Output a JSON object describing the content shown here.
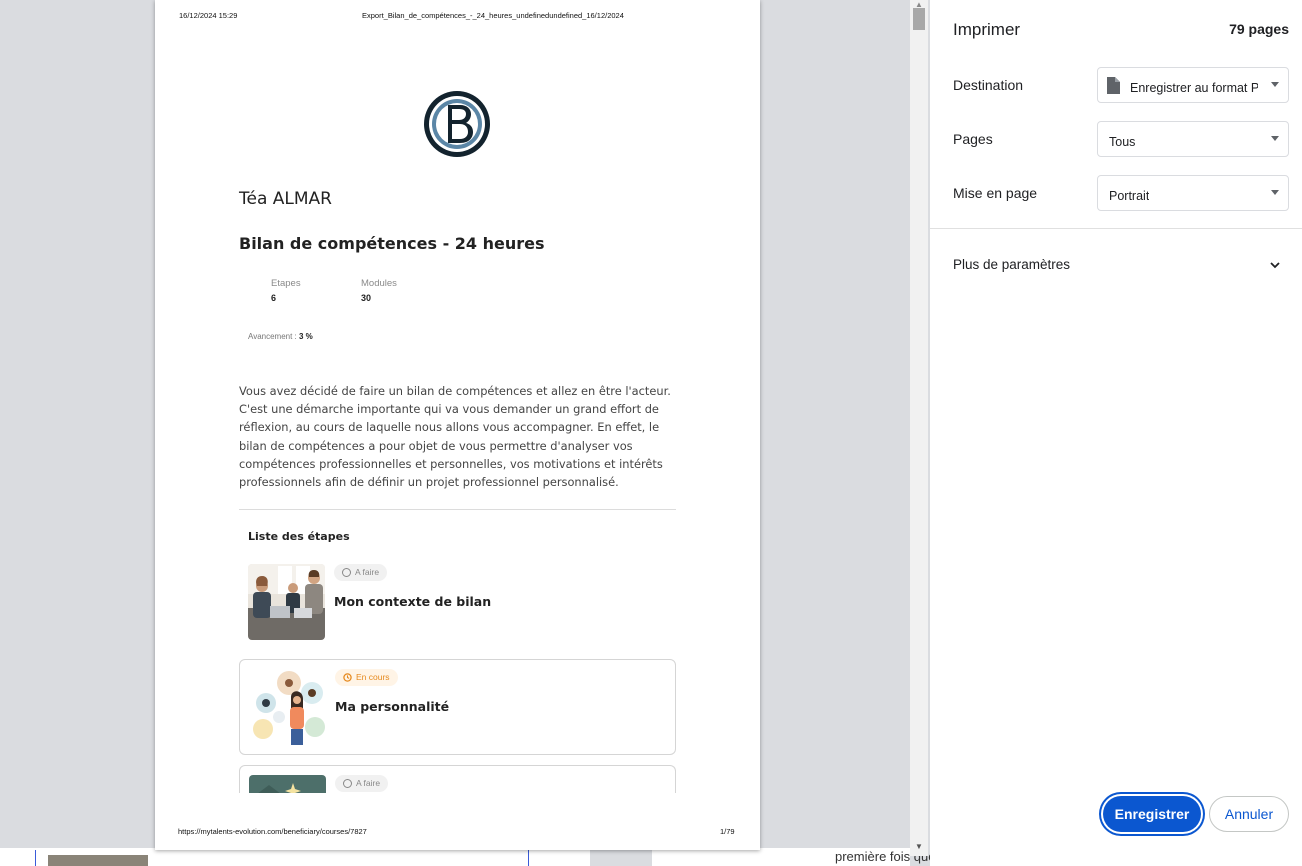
{
  "preview": {
    "header_date": "16/12/2024 15:29",
    "header_title": "Export_Bilan_de_compétences_-_24_heures_undefinedundefined_16/12/2024",
    "person_name": "Téa ALMAR",
    "course_title": "Bilan de compétences - 24 heures",
    "stats": [
      {
        "label": "Etapes",
        "value": "6"
      },
      {
        "label": "Modules",
        "value": "30"
      }
    ],
    "progress_label": "Avancement : ",
    "progress_value": "3 %",
    "intro_text": "Vous avez décidé de faire un bilan de compétences et allez en être l'acteur. C'est une démarche importante qui va vous demander un grand effort de réflexion, au cours de laquelle nous allons vous accompagner. En effet, le bilan de compétences a pour objet de vous permettre d'analyser vos compétences professionnelles et personnelles, vos motivations et intérêts professionnels afin de définir un projet professionnel personnalisé.",
    "steps_title": "Liste des étapes",
    "steps": [
      {
        "status": "A faire",
        "title": "Mon contexte de bilan"
      },
      {
        "status": "En cours",
        "title": "Ma personnalité"
      },
      {
        "status": "A faire",
        "title": ""
      }
    ],
    "footer_url": "https://mytalents-evolution.com/beneficiary/courses/7827",
    "footer_page": "1/79"
  },
  "background": {
    "text": "première fois que vous"
  },
  "print": {
    "title": "Imprimer",
    "page_count": "79 pages",
    "destination_label": "Destination",
    "destination_value": "Enregistrer au format PDF",
    "pages_label": "Pages",
    "pages_value": "Tous",
    "layout_label": "Mise en page",
    "layout_value": "Portrait",
    "more_settings": "Plus de paramètres",
    "save_button": "Enregistrer",
    "cancel_button": "Annuler"
  },
  "colors": {
    "primary": "#0b57d0",
    "in_progress": "#e68a1f"
  }
}
